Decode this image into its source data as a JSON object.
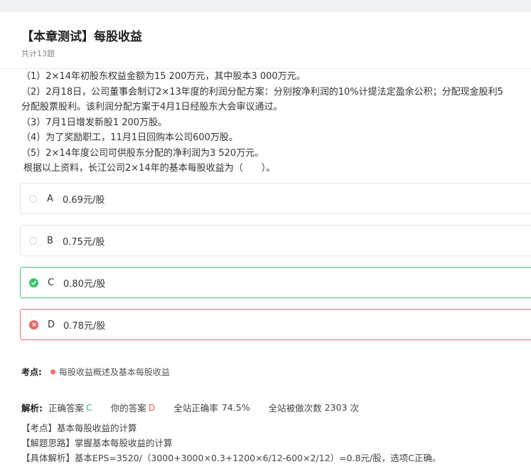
{
  "header": {
    "title": "【本章测试】每股收益",
    "subtitle": "共计13题"
  },
  "question": {
    "lines": [
      "（1）2×14年初股东权益金额为15 200万元，其中股本3 000万元。",
      "（2）2月18日，公司董事会制订2×13年度的利润分配方案：分别按净利润的10%计提法定盈余公积；分配现金股利5",
      "分配股票股利。该利润分配方案于4月1日经股东大会审议通过。",
      "（3）7月1日增发新股1 200万股。",
      "（4）为了奖励职工，11月1日回购本公司600万股。",
      "（5）2×14年度公司可供股东分配的净利润为3 520万元。",
      " 根据以上资料，长江公司2×14年的基本每股收益为（　　）。"
    ]
  },
  "options": [
    {
      "letter": "A",
      "text": "0.69元/股",
      "state": "normal"
    },
    {
      "letter": "B",
      "text": "0.75元/股",
      "state": "normal"
    },
    {
      "letter": "C",
      "text": "0.80元/股",
      "state": "correct"
    },
    {
      "letter": "D",
      "text": "0.78元/股",
      "state": "wrong"
    }
  ],
  "kaodian": {
    "label": "考点:",
    "text": "每股收益概述及基本每股收益"
  },
  "analysis": {
    "label": "解析:",
    "correct_label": "正确答案",
    "correct_value": "C",
    "your_label": "你的答案",
    "your_value": "D",
    "rate_label": "全站正确率",
    "rate_value": "74.5%",
    "count_label": "全站被做次数",
    "count_value": "2303",
    "count_unit": "次"
  },
  "detail": [
    "【考点】基本每股收益的计算",
    "【解题思路】掌握基本每股收益的计算",
    "【具体解析】基本EPS=3520/（3000+3000×0.3+1200×6/12-600×2/12）=0.8元/股，选项C正确。"
  ],
  "colors": {
    "correct": "#3cc06f",
    "wrong": "#ec6262",
    "dot": "#f56c5c"
  }
}
